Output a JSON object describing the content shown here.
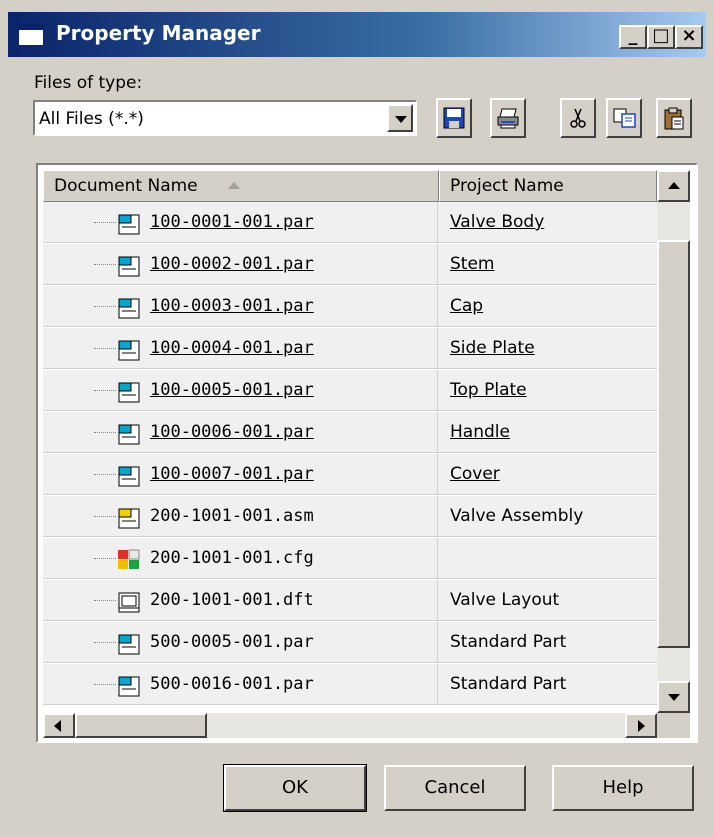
{
  "window": {
    "title": "Property Manager",
    "controls": [
      "_",
      "□",
      "×"
    ]
  },
  "files_of_type": {
    "label": "Files of type:",
    "value": "All Files (*.*)"
  },
  "toolbar": {
    "icons": [
      "save-icon",
      "print-icon",
      "cut-icon",
      "copy-icon",
      "paste-icon"
    ]
  },
  "table": {
    "columns": [
      "Document Name",
      "Project Name"
    ],
    "sort_indicator": "ascending",
    "rows": [
      {
        "name": "100-0001-001.par",
        "project": "Valve Body",
        "linked": true,
        "icon": "part-icon"
      },
      {
        "name": "100-0002-001.par",
        "project": "Stem",
        "linked": true,
        "icon": "part-icon"
      },
      {
        "name": "100-0003-001.par",
        "project": "Cap",
        "linked": true,
        "icon": "part-icon"
      },
      {
        "name": "100-0004-001.par",
        "project": "Side Plate",
        "linked": true,
        "icon": "part-icon"
      },
      {
        "name": "100-0005-001.par",
        "project": "Top Plate",
        "linked": true,
        "icon": "part-icon"
      },
      {
        "name": "100-0006-001.par",
        "project": "Handle",
        "linked": true,
        "icon": "part-icon"
      },
      {
        "name": "100-0007-001.par",
        "project": "Cover",
        "linked": true,
        "icon": "part-icon"
      },
      {
        "name": "200-1001-001.asm",
        "project": "Valve Assembly",
        "linked": false,
        "icon": "assembly-icon"
      },
      {
        "name": "200-1001-001.cfg",
        "project": "",
        "linked": false,
        "icon": "config-icon"
      },
      {
        "name": "200-1001-001.dft",
        "project": "Valve Layout",
        "linked": false,
        "icon": "draft-icon"
      },
      {
        "name": "500-0005-001.par",
        "project": "Standard Part",
        "linked": false,
        "icon": "part-icon"
      },
      {
        "name": "500-0016-001.par",
        "project": "Standard Part",
        "linked": false,
        "icon": "part-icon"
      }
    ]
  },
  "buttons": {
    "ok": "OK",
    "cancel": "Cancel",
    "help": "Help"
  },
  "colors": {
    "titlebar_start": "#0a246a",
    "titlebar_end": "#a6caf0",
    "face": "#d4d0c8"
  }
}
